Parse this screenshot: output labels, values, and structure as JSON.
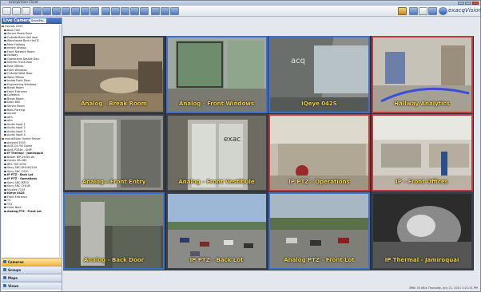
{
  "window": {
    "title": "exacqVision Client"
  },
  "brand": {
    "logo_text": "exacqVision"
  },
  "sidebar": {
    "header": "Live Cameras",
    "header_button": "Save/Ma...",
    "tree": [
      {
        "label": "Vsvrsot 2555",
        "level": 1,
        "bold": false
      },
      {
        "label": "Back Hall",
        "level": 2
      },
      {
        "label": "Server Room Door",
        "level": 2
      },
      {
        "label": "Outside Back Hall door",
        "level": 2
      },
      {
        "label": "Warehouse Back Hall D",
        "level": 2
      },
      {
        "label": "Main Hallway",
        "level": 2
      },
      {
        "label": "emory Analog",
        "level": 2
      },
      {
        "label": "Front Network Room",
        "level": 2
      },
      {
        "label": "Hallway",
        "level": 2
      },
      {
        "label": "Operations Double Doo",
        "level": 2
      },
      {
        "label": "Interior Front Door",
        "level": 2
      },
      {
        "label": "East Offices",
        "level": 2
      },
      {
        "label": "Front Windows",
        "level": 2
      },
      {
        "label": "Outside West Door",
        "level": 2
      },
      {
        "label": "West Offices",
        "level": 2
      },
      {
        "label": "Inside Front Door",
        "level": 2
      },
      {
        "label": "Engineering Windows",
        "level": 2
      },
      {
        "label": "Break Room",
        "level": 2
      },
      {
        "label": "Front Entrance",
        "level": 2
      },
      {
        "label": "Cafeteria",
        "level": 2
      },
      {
        "label": "Break Room",
        "level": 2
      },
      {
        "label": "Dock Bell",
        "level": 2
      },
      {
        "label": "Server Room",
        "level": 2
      },
      {
        "label": "Back Parking",
        "level": 2
      },
      {
        "label": "accum",
        "level": 2
      },
      {
        "label": "atm",
        "level": 2
      },
      {
        "label": "atm",
        "level": 2
      },
      {
        "label": "Audio Input 1",
        "level": 2
      },
      {
        "label": "Audio Input 2",
        "level": 2
      },
      {
        "label": "Audio Input 3",
        "level": 2
      },
      {
        "label": "Audio Input 4",
        "level": 2
      },
      {
        "label": "exacqVision Hybrid Server",
        "level": 1
      },
      {
        "label": "Arecont 5535",
        "level": 2
      },
      {
        "label": "AXIS Q1755 Dome",
        "level": 2
      },
      {
        "label": "AXIS P3346 - SHIP",
        "level": 2
      },
      {
        "label": "IP Thermal - Jamiroquai",
        "level": 2,
        "bold": true
      },
      {
        "label": "Basler BIP-2500c-dn",
        "level": 2
      },
      {
        "label": "Canon VB-C60",
        "level": 2
      },
      {
        "label": "IRIS 300 2000",
        "level": 2
      },
      {
        "label": "Sony SNC-DH140/140",
        "level": 2
      },
      {
        "label": "Sony SNC-CS20",
        "level": 2
      },
      {
        "label": "IP PTZ - Back Lot",
        "level": 2,
        "bold": true
      },
      {
        "label": "IP PTZ - Operations",
        "level": 2,
        "bold": true
      },
      {
        "label": "Sony SNC-RZ50",
        "level": 2
      },
      {
        "label": "Sony SNC-CH140",
        "level": 2
      },
      {
        "label": "Vivotek 7135",
        "level": 2
      },
      {
        "label": "IQeye 042S",
        "level": 2,
        "bold": true
      },
      {
        "label": "Front Entrance",
        "level": 2
      },
      {
        "label": "TV",
        "level": 2
      },
      {
        "label": "TV2",
        "level": 2
      },
      {
        "label": "Color Bars",
        "level": 2
      },
      {
        "label": "Analog PTZ - Front Lot",
        "level": 2,
        "bold": true
      }
    ],
    "nav": [
      {
        "label": "Cameras",
        "active": true
      },
      {
        "label": "Groups",
        "active": false
      },
      {
        "label": "Maps",
        "active": false
      },
      {
        "label": "Views",
        "active": false
      }
    ]
  },
  "cameras": [
    {
      "caption": "Analog - Break Room",
      "border": "none"
    },
    {
      "caption": "Analog - Front Windows",
      "border": "blue"
    },
    {
      "caption": "IQeye 042S",
      "border": "blue"
    },
    {
      "caption": "Hallway Analytics",
      "border": "red"
    },
    {
      "caption": "Analog - Front Entry",
      "border": "none"
    },
    {
      "caption": "Analog - Front Vestibule",
      "border": "none"
    },
    {
      "caption": "IP PTZ - Operations",
      "border": "red"
    },
    {
      "caption": "IP - Front Offices",
      "border": "red"
    },
    {
      "caption": "Analog - Back Door",
      "border": "blue"
    },
    {
      "caption": "IP PTZ - Back Lot",
      "border": "none"
    },
    {
      "caption": "Analog PTZ - Front Lot",
      "border": "blue"
    },
    {
      "caption": "IP Thermal - Jamiroquai",
      "border": "none"
    }
  ],
  "colors": {
    "caption": "#f3d347",
    "accent": "#2f5fa8",
    "alarm_border": "#c23a3a",
    "ptz_border": "#3d6fd6"
  },
  "status": {
    "text": "396k 34 kB/s   Thursday, July 21, 2011  3:21:31 PM"
  }
}
